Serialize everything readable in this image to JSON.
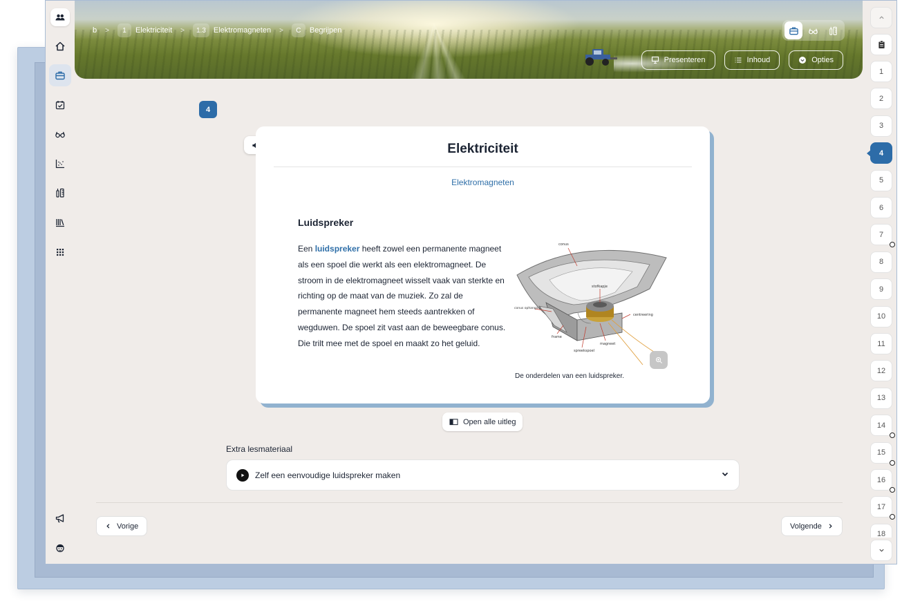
{
  "breadcrumb": {
    "root": "b",
    "items": [
      {
        "num": "1",
        "label": "Elektriciteit"
      },
      {
        "num": "1.3",
        "label": "Elektromagneten"
      },
      {
        "num": "C",
        "label": "Begrijpen"
      }
    ],
    "separator": ">"
  },
  "banner_actions": {
    "present": "Presenteren",
    "contents": "Inhoud",
    "options": "Opties"
  },
  "mode_switch": [
    "briefcase-icon",
    "glasses-icon",
    "tools-icon"
  ],
  "left_rail": [
    "users-icon",
    "home-icon",
    "briefcase-icon",
    "calendar-check-icon",
    "glasses-icon",
    "chart-icon",
    "tools-icon",
    "library-icon",
    "grid-icon",
    "megaphone-icon",
    "avatar-icon"
  ],
  "current_page_badge": "4",
  "card": {
    "title": "Elektriciteit",
    "subtitle": "Elektromagneten",
    "section_title": "Luidspreker",
    "text_before": "Een ",
    "keyword": "luidspreker",
    "text_after": " heeft zowel een permanente magneet als een spoel die werkt als een elektromagneet. De stroom in de elektromagneet wisselt vaak van sterkte en richting op de maat van de muziek. Zo zal de permanente magneet hem steeds aantrekken of wegduwen. De spoel zit vast aan de beweegbare conus. Die trilt mee met de spoel en maakt zo het geluid.",
    "diagram_labels": {
      "conus": "conus",
      "stofkapje": "stofkapje",
      "ophanging": "conus ophanging",
      "centreering": "centreering",
      "frame": "frame",
      "magneet": "magneet",
      "spreekspoel": "spreekspoel"
    },
    "caption": "De onderdelen van een luidspreker."
  },
  "open_all": "Open alle uitleg",
  "extra": {
    "label": "Extra lesmateriaal",
    "item": "Zelf een eenvoudige luidspreker maken"
  },
  "nav": {
    "prev": "Vorige",
    "next": "Volgende"
  },
  "pages": [
    {
      "n": "1",
      "dot": false
    },
    {
      "n": "2",
      "dot": false
    },
    {
      "n": "3",
      "dot": false
    },
    {
      "n": "4",
      "dot": false,
      "active": true
    },
    {
      "n": "5",
      "dot": false
    },
    {
      "n": "6",
      "dot": false
    },
    {
      "n": "7",
      "dot": true
    },
    {
      "n": "8",
      "dot": false
    },
    {
      "n": "9",
      "dot": false
    },
    {
      "n": "10",
      "dot": false
    },
    {
      "n": "11",
      "dot": false
    },
    {
      "n": "12",
      "dot": false
    },
    {
      "n": "13",
      "dot": false
    },
    {
      "n": "14",
      "dot": true
    },
    {
      "n": "15",
      "dot": true
    },
    {
      "n": "16",
      "dot": true
    },
    {
      "n": "17",
      "dot": true
    },
    {
      "n": "18",
      "dot": false
    }
  ],
  "colors": {
    "accent": "#2d6ca8",
    "card_shadow": "#91b2cf",
    "background": "#f0ece9"
  }
}
